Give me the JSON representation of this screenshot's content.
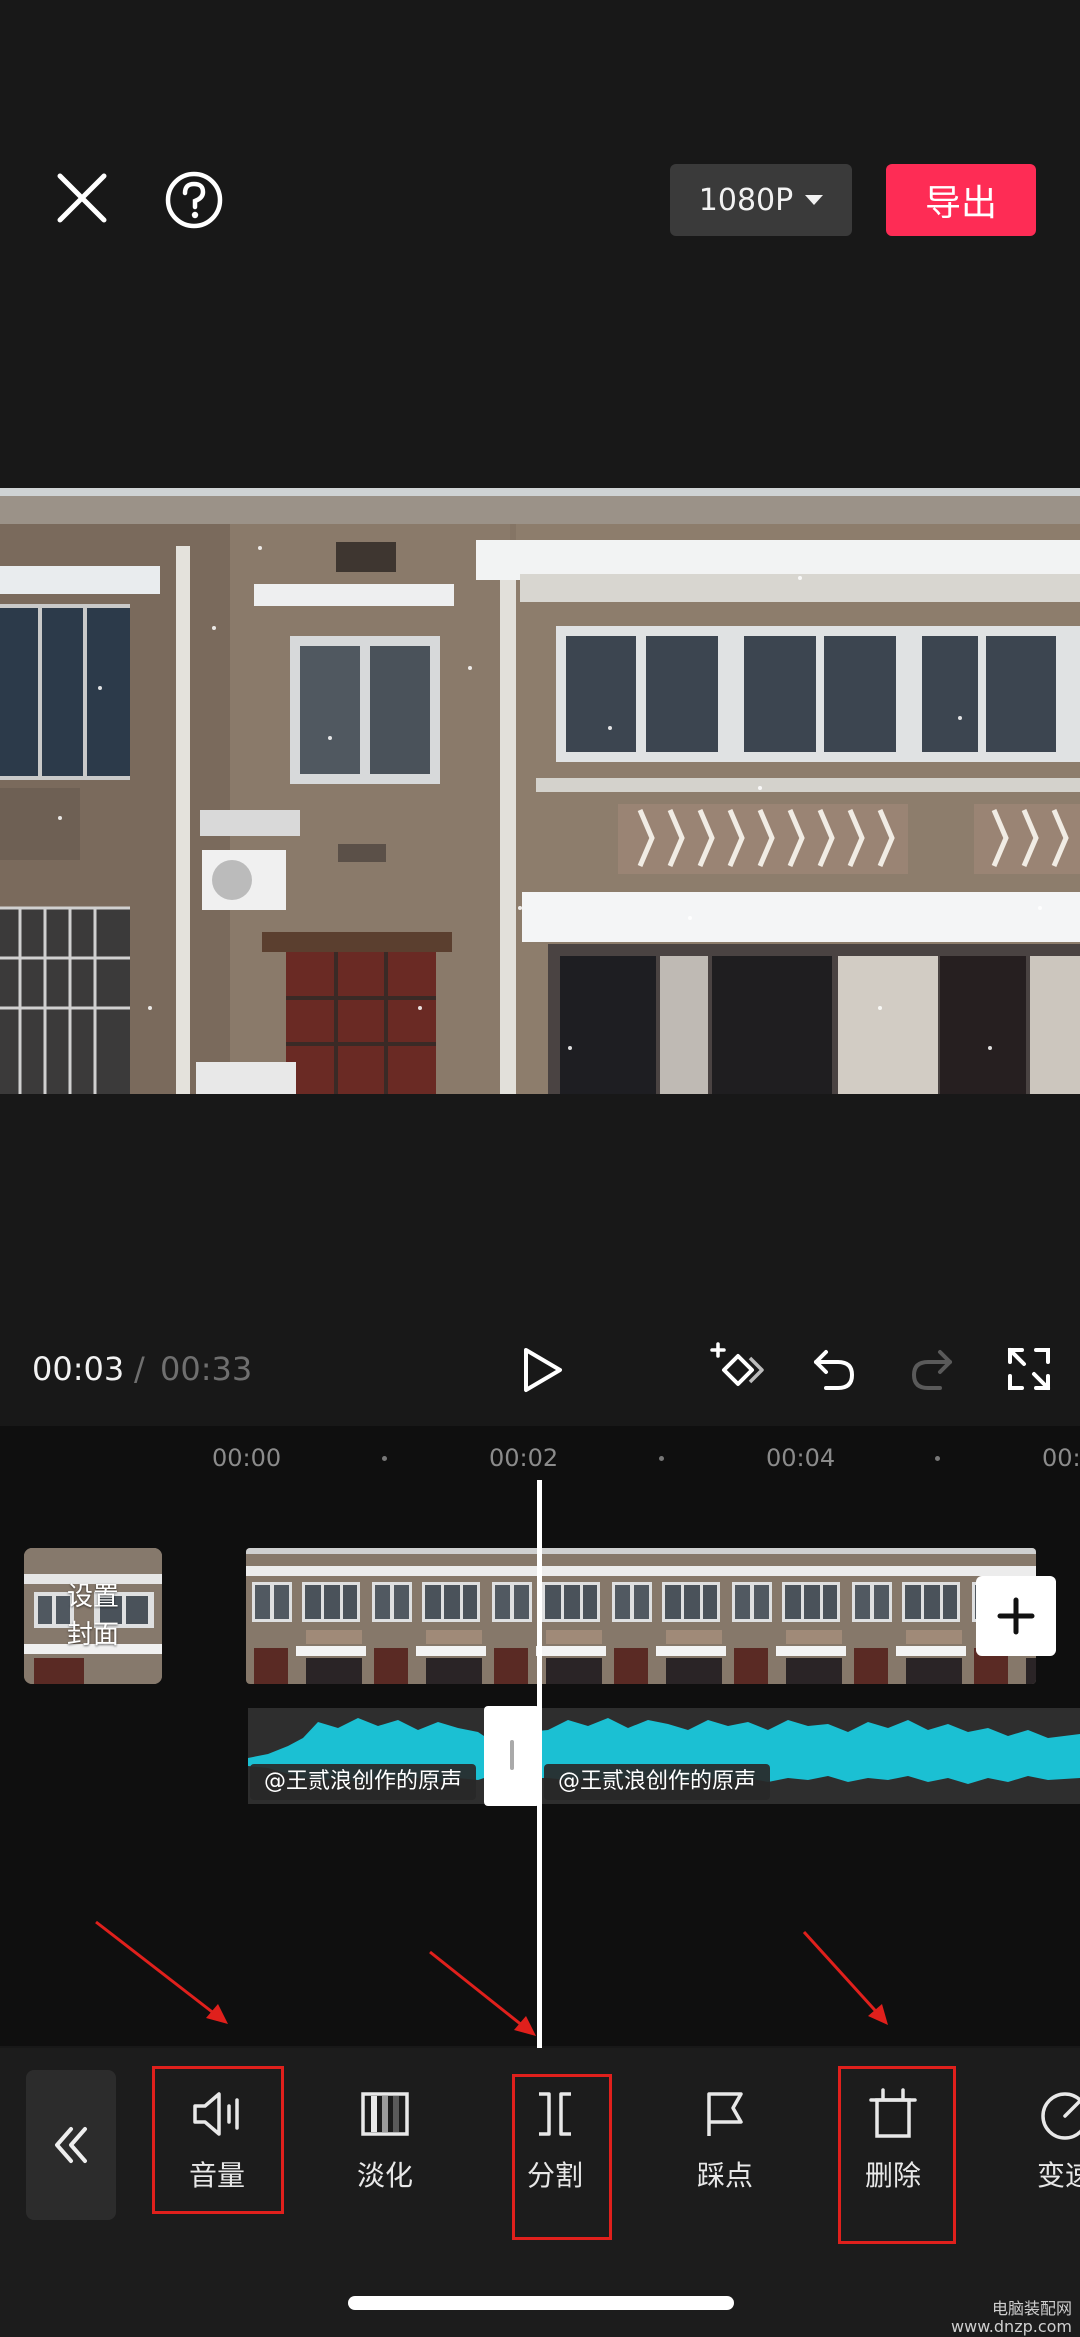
{
  "top_bar": {
    "resolution_label": "1080P",
    "export_label": "导出"
  },
  "playback": {
    "current_time": "00:03",
    "separator": "/",
    "total_time": "00:33"
  },
  "timeline": {
    "ruler_labels": [
      "00:00",
      "00:02",
      "00:04",
      "00:"
    ],
    "cover_label_line1": "设置",
    "cover_label_line2": "封面",
    "audio_labels": [
      "@王贰浪创作的原声",
      "@王贰浪创作的原声"
    ]
  },
  "toolbar": {
    "items": [
      {
        "label": "音量",
        "icon": "speaker-icon"
      },
      {
        "label": "淡化",
        "icon": "fade-icon"
      },
      {
        "label": "分割",
        "icon": "split-icon"
      },
      {
        "label": "踩点",
        "icon": "flag-icon"
      },
      {
        "label": "删除",
        "icon": "trash-icon"
      },
      {
        "label": "变速",
        "icon": "speed-icon"
      }
    ]
  },
  "colors": {
    "accent": "#fe2c55",
    "audio_wave": "#1bc0d3",
    "annotation": "#e0201c"
  },
  "watermark": {
    "line1": "电脑装配网",
    "line2": "www.dnzp.com"
  }
}
